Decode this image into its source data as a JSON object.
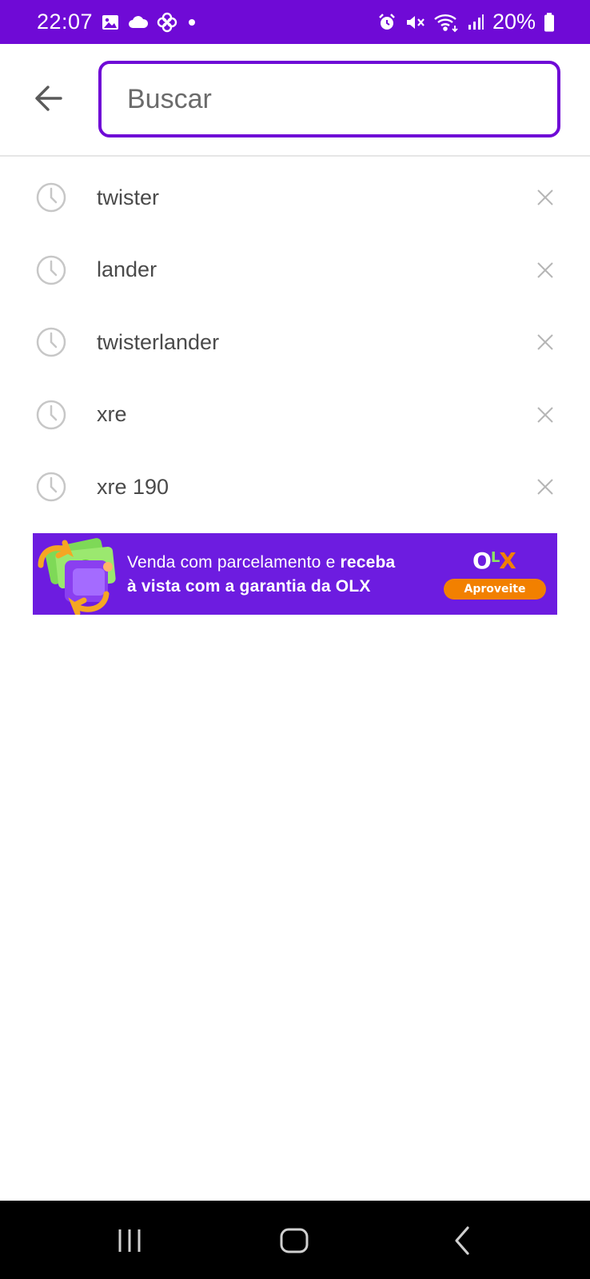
{
  "status_bar": {
    "time": "22:07",
    "battery_percent": "20%",
    "left_icons": [
      "gallery-icon",
      "cloud-icon",
      "pinwheel-icon",
      "dot-icon"
    ],
    "right_icons": [
      "alarm-icon",
      "mute-icon",
      "wifi-icon",
      "signal-icon",
      "battery-icon"
    ]
  },
  "search": {
    "placeholder": "Buscar",
    "value": ""
  },
  "history": {
    "items": [
      {
        "label": "twister"
      },
      {
        "label": "lander"
      },
      {
        "label": "twisterlander"
      },
      {
        "label": "xre"
      },
      {
        "label": "xre 190"
      }
    ]
  },
  "banner": {
    "line1_normal": "Venda com parcelamento e ",
    "line1_bold": "receba",
    "line2_bold": "à vista com a garantia da OLX",
    "logo": {
      "o": "O",
      "l": "L",
      "x": "X"
    },
    "cta": "Aproveite"
  },
  "colors": {
    "accent": "#6f0ad6",
    "banner_bg": "#6d1ce0",
    "olx_orange": "#f28000",
    "olx_green": "#8ce563"
  }
}
